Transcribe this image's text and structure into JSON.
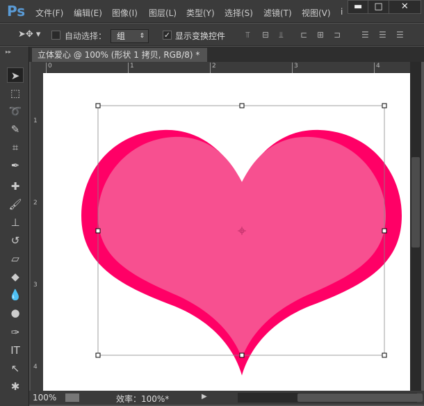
{
  "app": {
    "logo": "Ps"
  },
  "menu": [
    "文件(F)",
    "编辑(E)",
    "图像(I)",
    "图层(L)",
    "类型(Y)",
    "选择(S)",
    "滤镜(T)",
    "视图(V)",
    "i"
  ],
  "window_controls": {
    "minimize": "▬",
    "maximize": "□",
    "close": "✕"
  },
  "options": {
    "auto_select_label": "自动选择：",
    "auto_select_checked": false,
    "auto_select_value": "组",
    "show_transform_label": "显示变换控件",
    "show_transform_checked": true
  },
  "document_tab": {
    "title": "立体爱心 @ 100% (形状 1 拷贝, RGB/8) *",
    "close": "×"
  },
  "ruler": {
    "h_labels": [
      "0",
      "1",
      "2",
      "3",
      "4"
    ],
    "v_labels": [
      "1",
      "2",
      "3",
      "4"
    ]
  },
  "status": {
    "zoom": "100%",
    "efficiency": "效率：100%*"
  },
  "colors": {
    "heart_outer": "#ff0066",
    "heart_inner": "#f75090",
    "canvas": "#ffffff"
  }
}
